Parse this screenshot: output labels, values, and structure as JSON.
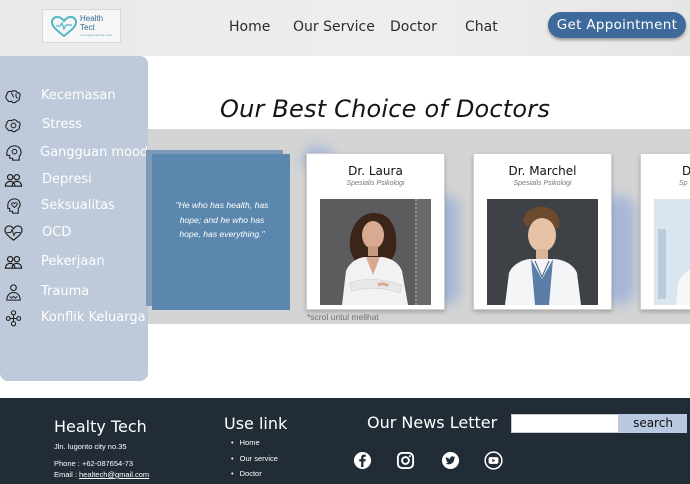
{
  "header": {
    "logo_name": "Health Tect",
    "logo_tagline": "Kesehatan Mental Anda",
    "nav": [
      "Home",
      "Our Service",
      "Doctor",
      "Chat"
    ],
    "cta_label": "Get  Appointment"
  },
  "sidebar": {
    "items": [
      {
        "label": "Kecemasan",
        "icon": "brain-icon"
      },
      {
        "label": "Stress",
        "icon": "brain-gear-icon"
      },
      {
        "label": "Gangguan mood",
        "icon": "mood-head-icon"
      },
      {
        "label": "Depresi",
        "icon": "people-icon"
      },
      {
        "label": "Seksualitas",
        "icon": "head-heart-icon"
      },
      {
        "label": "OCD",
        "icon": "heartbeat-icon"
      },
      {
        "label": "Pekerjaan",
        "icon": "team-icon"
      },
      {
        "label": "Trauma",
        "icon": "trauma-icon"
      },
      {
        "label": "Konflik Keluarga",
        "icon": "family-tree-icon"
      }
    ]
  },
  "main": {
    "title": "Our Best Choice of Doctors",
    "quote": "\"He who has health, has hope; and he who has hope, has everything.\"",
    "doctors": [
      {
        "name": "Dr. Laura",
        "specialty": "Spesialis Psikologi"
      },
      {
        "name": "Dr. Marchel",
        "specialty": "Spesialis Psikologi"
      },
      {
        "name": "Dr.",
        "specialty": "Sp"
      }
    ],
    "scroll_hint": "*scrol untul melihat"
  },
  "footer": {
    "brand": "Healty Tech",
    "address": "Jln. lugonto city no.35",
    "phone": "Phone : +62-087654-73",
    "email_label": "Email  : ",
    "email": "healtech@gmail.com",
    "use_link_title": "Use link",
    "links": [
      "Home",
      "Our service",
      "Doctor"
    ],
    "newsletter_title": "Our News Letter",
    "search_placeholder": "",
    "search_label": "search",
    "social": [
      "facebook-icon",
      "instagram-icon",
      "twitter-icon",
      "youtube-icon"
    ]
  },
  "colors": {
    "accent": "#3d6a9a",
    "sidebar": "#bec9d9",
    "quote_card": "#5b87ae",
    "footer": "#212c36"
  }
}
